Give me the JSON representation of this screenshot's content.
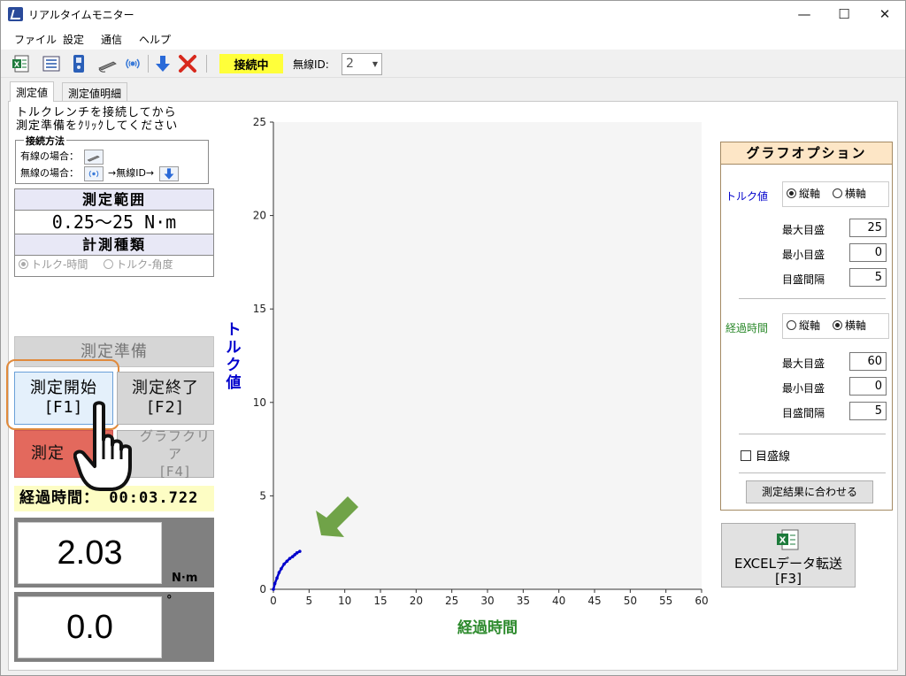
{
  "window": {
    "title": "リアルタイムモニター",
    "controls": {
      "minimize": "—",
      "maximize": "☐",
      "close": "✕"
    }
  },
  "menu": [
    "ファイル",
    "設定",
    "通信",
    "ヘルプ"
  ],
  "toolbar": {
    "icons": [
      "excel-export-icon",
      "list-icon",
      "device-icon",
      "wired-torque-wrench-icon",
      "wireless-icon",
      "download-arrow-icon",
      "disconnect-x-icon"
    ],
    "status": "接続中",
    "status_color": "#ffff3a",
    "wireless_id_label": "無線ID:",
    "wireless_id_value": "2"
  },
  "tabs": [
    "測定値",
    "測定値明細"
  ],
  "left_panel": {
    "instruction_line1": "トルクレンチを接続してから",
    "instruction_line2": "測定準備をｸﾘｯｸしてください",
    "connection": {
      "title": "接続方法",
      "wired_label": "有線の場合：",
      "wireless_label": "無線の場合：",
      "wireless_mid": "→無線ID→"
    },
    "range_header": "測定範囲",
    "range_value": "0.25～25 N·m",
    "type_header": "計測種類",
    "type_option_time": "トルク-時間",
    "type_option_angle": "トルク-角度",
    "btn_prepare": "測定準備",
    "btn_start_line1": "測定開始",
    "btn_start_line2": "[F1]",
    "btn_stop_line1": "測定終了",
    "btn_stop_line2": "[F2]",
    "btn_save": "測定",
    "btn_clear_line1": "グラフクリア",
    "btn_clear_line2": "[F4]",
    "elapsed": "経過時間： 00:03.722",
    "torque_value": "2.03",
    "torque_unit": "N·m",
    "angle_value": "0.0",
    "angle_unit": "°"
  },
  "chart_data": {
    "type": "line",
    "title": "",
    "xlabel": "経過時間",
    "ylabel": "トルク値",
    "xlim": [
      0,
      60
    ],
    "ylim": [
      0,
      25
    ],
    "xticks": [
      0,
      5,
      10,
      15,
      20,
      25,
      30,
      35,
      40,
      45,
      50,
      55,
      60
    ],
    "yticks": [
      0,
      5,
      10,
      15,
      20,
      25
    ],
    "grid": false,
    "series": [
      {
        "color": "#0000cc",
        "x": [
          0,
          0.2,
          0.5,
          0.8,
          1.1,
          1.5,
          1.9,
          2.3,
          2.7,
          3.0,
          3.3,
          3.7
        ],
        "y": [
          0,
          0.3,
          0.6,
          0.9,
          1.1,
          1.35,
          1.5,
          1.65,
          1.75,
          1.85,
          1.95,
          2.03
        ]
      }
    ],
    "xlabel_color": "#2e8b2e",
    "ylabel_color": "#0000cc"
  },
  "graph_options": {
    "title": "グラフオプション",
    "torque_label": "トルク値",
    "torque_label_color": "#0000cc",
    "time_label": "経過時間",
    "time_label_color": "#2e8b2e",
    "vertical": "縦軸",
    "horizontal": "横軸",
    "torque_axis": "縦軸",
    "time_axis": "横軸",
    "max_label": "最大目盛",
    "min_label": "最小目盛",
    "interval_label": "目盛間隔",
    "torque_max": "25",
    "torque_min": "0",
    "torque_interval": "5",
    "time_max": "60",
    "time_min": "0",
    "time_interval": "5",
    "gridline_label": "目盛線",
    "gridline_checked": false,
    "fit_button": "測定結果に合わせる"
  },
  "excel_button": {
    "line1": "EXCELデータ転送",
    "line2": "[F3]"
  }
}
